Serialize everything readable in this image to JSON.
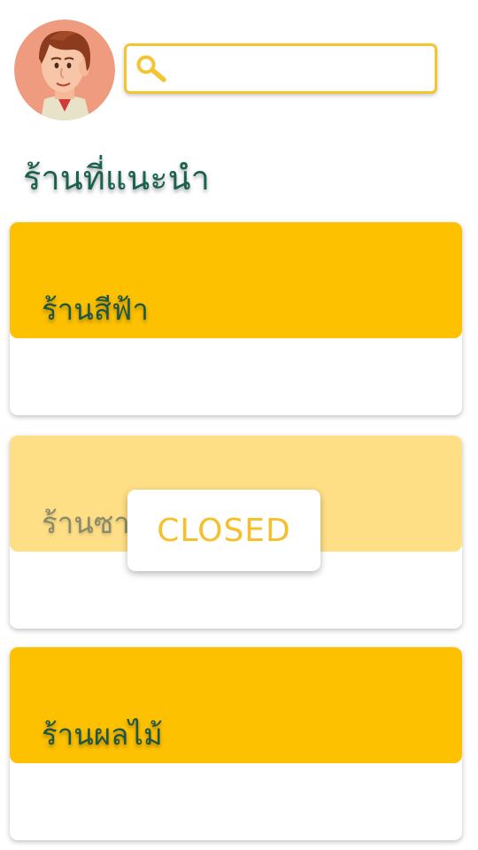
{
  "header": {
    "avatar_icon": "profile-avatar-icon",
    "search": {
      "icon": "search-icon",
      "value": "",
      "placeholder": ""
    }
  },
  "section_title": "ร้านที่แนะนำ",
  "shops": [
    {
      "name": "ร้านสีฟ้า",
      "status": "open"
    },
    {
      "name": "ร้านซาก",
      "status": "closed"
    },
    {
      "name": "ร้านผลไม้",
      "status": "open"
    }
  ],
  "closed_label": "CLOSED",
  "colors": {
    "accent": "#fdc100",
    "accent_faded": "#fedf86",
    "search_border": "#f5c431",
    "title_text": "#1b6150"
  }
}
